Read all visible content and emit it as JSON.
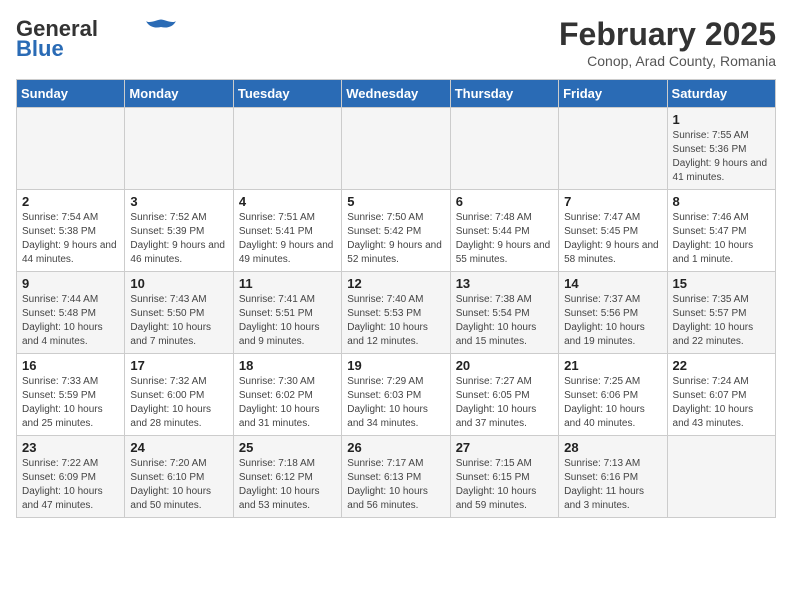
{
  "header": {
    "logo_general": "General",
    "logo_blue": "Blue",
    "month_year": "February 2025",
    "location": "Conop, Arad County, Romania"
  },
  "weekdays": [
    "Sunday",
    "Monday",
    "Tuesday",
    "Wednesday",
    "Thursday",
    "Friday",
    "Saturday"
  ],
  "weeks": [
    {
      "days": [
        {
          "num": "",
          "detail": ""
        },
        {
          "num": "",
          "detail": ""
        },
        {
          "num": "",
          "detail": ""
        },
        {
          "num": "",
          "detail": ""
        },
        {
          "num": "",
          "detail": ""
        },
        {
          "num": "",
          "detail": ""
        },
        {
          "num": "1",
          "detail": "Sunrise: 7:55 AM\nSunset: 5:36 PM\nDaylight: 9 hours and 41 minutes."
        }
      ]
    },
    {
      "days": [
        {
          "num": "2",
          "detail": "Sunrise: 7:54 AM\nSunset: 5:38 PM\nDaylight: 9 hours and 44 minutes."
        },
        {
          "num": "3",
          "detail": "Sunrise: 7:52 AM\nSunset: 5:39 PM\nDaylight: 9 hours and 46 minutes."
        },
        {
          "num": "4",
          "detail": "Sunrise: 7:51 AM\nSunset: 5:41 PM\nDaylight: 9 hours and 49 minutes."
        },
        {
          "num": "5",
          "detail": "Sunrise: 7:50 AM\nSunset: 5:42 PM\nDaylight: 9 hours and 52 minutes."
        },
        {
          "num": "6",
          "detail": "Sunrise: 7:48 AM\nSunset: 5:44 PM\nDaylight: 9 hours and 55 minutes."
        },
        {
          "num": "7",
          "detail": "Sunrise: 7:47 AM\nSunset: 5:45 PM\nDaylight: 9 hours and 58 minutes."
        },
        {
          "num": "8",
          "detail": "Sunrise: 7:46 AM\nSunset: 5:47 PM\nDaylight: 10 hours and 1 minute."
        }
      ]
    },
    {
      "days": [
        {
          "num": "9",
          "detail": "Sunrise: 7:44 AM\nSunset: 5:48 PM\nDaylight: 10 hours and 4 minutes."
        },
        {
          "num": "10",
          "detail": "Sunrise: 7:43 AM\nSunset: 5:50 PM\nDaylight: 10 hours and 7 minutes."
        },
        {
          "num": "11",
          "detail": "Sunrise: 7:41 AM\nSunset: 5:51 PM\nDaylight: 10 hours and 9 minutes."
        },
        {
          "num": "12",
          "detail": "Sunrise: 7:40 AM\nSunset: 5:53 PM\nDaylight: 10 hours and 12 minutes."
        },
        {
          "num": "13",
          "detail": "Sunrise: 7:38 AM\nSunset: 5:54 PM\nDaylight: 10 hours and 15 minutes."
        },
        {
          "num": "14",
          "detail": "Sunrise: 7:37 AM\nSunset: 5:56 PM\nDaylight: 10 hours and 19 minutes."
        },
        {
          "num": "15",
          "detail": "Sunrise: 7:35 AM\nSunset: 5:57 PM\nDaylight: 10 hours and 22 minutes."
        }
      ]
    },
    {
      "days": [
        {
          "num": "16",
          "detail": "Sunrise: 7:33 AM\nSunset: 5:59 PM\nDaylight: 10 hours and 25 minutes."
        },
        {
          "num": "17",
          "detail": "Sunrise: 7:32 AM\nSunset: 6:00 PM\nDaylight: 10 hours and 28 minutes."
        },
        {
          "num": "18",
          "detail": "Sunrise: 7:30 AM\nSunset: 6:02 PM\nDaylight: 10 hours and 31 minutes."
        },
        {
          "num": "19",
          "detail": "Sunrise: 7:29 AM\nSunset: 6:03 PM\nDaylight: 10 hours and 34 minutes."
        },
        {
          "num": "20",
          "detail": "Sunrise: 7:27 AM\nSunset: 6:05 PM\nDaylight: 10 hours and 37 minutes."
        },
        {
          "num": "21",
          "detail": "Sunrise: 7:25 AM\nSunset: 6:06 PM\nDaylight: 10 hours and 40 minutes."
        },
        {
          "num": "22",
          "detail": "Sunrise: 7:24 AM\nSunset: 6:07 PM\nDaylight: 10 hours and 43 minutes."
        }
      ]
    },
    {
      "days": [
        {
          "num": "23",
          "detail": "Sunrise: 7:22 AM\nSunset: 6:09 PM\nDaylight: 10 hours and 47 minutes."
        },
        {
          "num": "24",
          "detail": "Sunrise: 7:20 AM\nSunset: 6:10 PM\nDaylight: 10 hours and 50 minutes."
        },
        {
          "num": "25",
          "detail": "Sunrise: 7:18 AM\nSunset: 6:12 PM\nDaylight: 10 hours and 53 minutes."
        },
        {
          "num": "26",
          "detail": "Sunrise: 7:17 AM\nSunset: 6:13 PM\nDaylight: 10 hours and 56 minutes."
        },
        {
          "num": "27",
          "detail": "Sunrise: 7:15 AM\nSunset: 6:15 PM\nDaylight: 10 hours and 59 minutes."
        },
        {
          "num": "28",
          "detail": "Sunrise: 7:13 AM\nSunset: 6:16 PM\nDaylight: 11 hours and 3 minutes."
        },
        {
          "num": "",
          "detail": ""
        }
      ]
    }
  ]
}
